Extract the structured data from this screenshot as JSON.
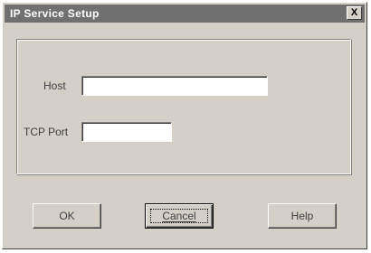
{
  "window": {
    "title": "IP Service Setup",
    "close_label": "X"
  },
  "form": {
    "host_label": "Host",
    "host_value": "",
    "port_label": "TCP Port",
    "port_value": ""
  },
  "buttons": {
    "ok_label": "OK",
    "cancel_label": "Cancel",
    "help_label": "Help"
  }
}
